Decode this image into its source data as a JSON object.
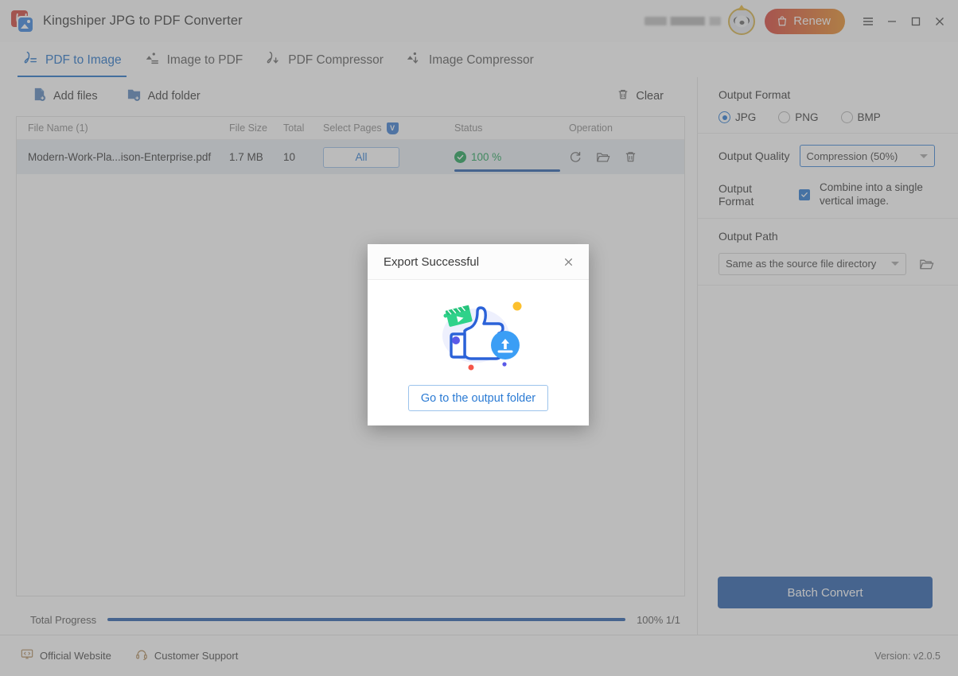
{
  "window": {
    "app_title": "Kingshiper JPG to PDF Converter",
    "app_icon": "pdf-to-image-app-icon",
    "renew_label": "Renew",
    "renew_icon": "shopping-bag-icon",
    "menu_icon": "hamburger-menu-icon",
    "minimize_icon": "minimize-icon",
    "maximize_icon": "maximize-icon",
    "close_icon": "close-icon",
    "avatar_icon": "user-avatar-crown-icon",
    "accent_blue": "#2573c8",
    "renew_gradient_from": "#d9453c",
    "renew_gradient_to": "#e8902c"
  },
  "tabs": [
    {
      "label": "PDF to Image",
      "icon": "pdf-to-image-icon",
      "active": true
    },
    {
      "label": "Image to PDF",
      "icon": "image-to-pdf-icon",
      "active": false
    },
    {
      "label": "PDF Compressor",
      "icon": "pdf-compressor-icon",
      "active": false
    },
    {
      "label": "Image Compressor",
      "icon": "image-compressor-icon",
      "active": false
    }
  ],
  "toolbar": {
    "add_files_label": "Add files",
    "add_files_icon": "add-file-icon",
    "add_folder_label": "Add folder",
    "add_folder_icon": "add-folder-icon",
    "clear_label": "Clear",
    "clear_icon": "trash-icon"
  },
  "file_table": {
    "headers": {
      "name": "File Name (1)",
      "size": "File Size",
      "total": "Total",
      "pages": "Select Pages",
      "pages_badge": "V",
      "status": "Status",
      "operation": "Operation"
    },
    "rows": [
      {
        "name": "Modern-Work-Pla...ison-Enterprise.pdf",
        "size": "1.7 MB",
        "total": "10",
        "pages_button": "All",
        "status_percent": "100 %",
        "progress": 100,
        "status_color": "#23a45a",
        "ops": [
          "refresh-icon",
          "open-folder-icon",
          "delete-icon"
        ]
      }
    ]
  },
  "total_progress": {
    "label": "Total Progress",
    "percent": 100,
    "value_text": "100% 1/1"
  },
  "settings": {
    "output_format_title": "Output Format",
    "formats": [
      {
        "label": "JPG",
        "selected": true
      },
      {
        "label": "PNG",
        "selected": false
      },
      {
        "label": "BMP",
        "selected": false
      }
    ],
    "output_quality_label": "Output Quality",
    "output_quality_value": "Compression (50%)",
    "combine_label": "Output Format",
    "combine_checkbox_text": "Combine into a single vertical image.",
    "combine_checked": true,
    "output_path_title": "Output Path",
    "output_path_value": "Same as the source file directory",
    "browse_icon": "open-folder-icon",
    "batch_convert_label": "Batch Convert",
    "batch_button_color": "#2b62ad"
  },
  "footer": {
    "website_label": "Official Website",
    "website_icon": "monitor-code-icon",
    "support_label": "Customer Support",
    "support_icon": "headset-icon",
    "version": "Version: v2.0.5"
  },
  "modal": {
    "title": "Export Successful",
    "close_icon": "close-icon",
    "illustration": "thumbs-up-upload-illustration",
    "button_label": "Go to the output folder",
    "button_text_color": "#2b7bd4"
  }
}
